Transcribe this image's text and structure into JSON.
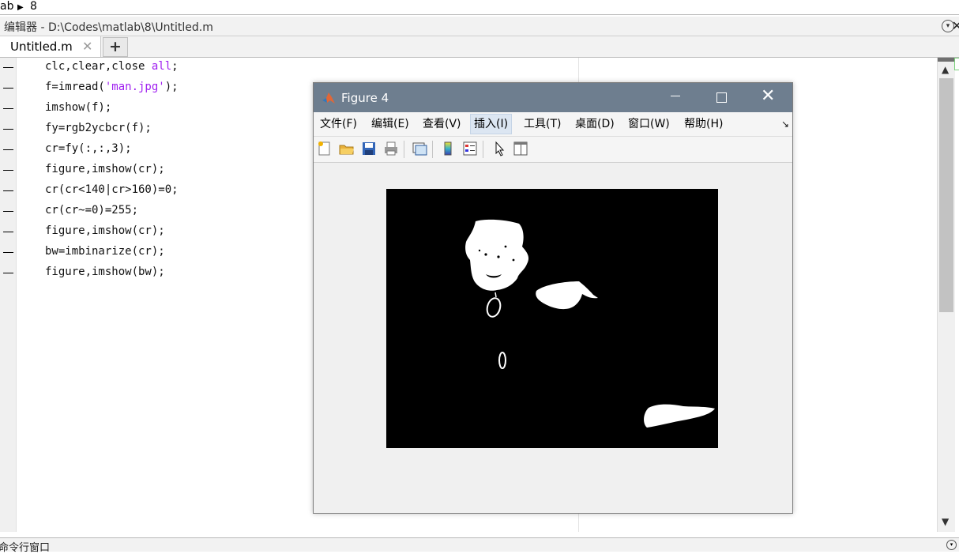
{
  "breadcrumb": {
    "left_text": "ab",
    "current": "8"
  },
  "editor": {
    "title": "编辑器 - D:\\Codes\\matlab\\8\\Untitled.m",
    "tabs": [
      {
        "label": "Untitled.m"
      }
    ],
    "add_tab": "+",
    "close_tab": "✕"
  },
  "code_lines": [
    {
      "parts": [
        {
          "t": "clc,clear,close ",
          "c": "plain"
        },
        {
          "t": "all",
          "c": "kw"
        },
        {
          "t": ";",
          "c": "plain"
        }
      ]
    },
    {
      "parts": [
        {
          "t": "f=imread(",
          "c": "plain"
        },
        {
          "t": "'man.jpg'",
          "c": "str"
        },
        {
          "t": ");",
          "c": "plain"
        }
      ]
    },
    {
      "parts": [
        {
          "t": "imshow(f);",
          "c": "plain"
        }
      ]
    },
    {
      "parts": [
        {
          "t": "fy=rgb2ycbcr(f);",
          "c": "plain"
        }
      ]
    },
    {
      "parts": [
        {
          "t": "cr=fy(:,:,3);",
          "c": "plain"
        }
      ]
    },
    {
      "parts": [
        {
          "t": "figure,imshow(cr);",
          "c": "plain"
        }
      ]
    },
    {
      "parts": [
        {
          "t": "cr(cr<140|cr>160)=0;",
          "c": "plain"
        }
      ]
    },
    {
      "parts": [
        {
          "t": "cr(cr~=0)=255;",
          "c": "plain"
        }
      ]
    },
    {
      "parts": [
        {
          "t": "figure,imshow(cr);",
          "c": "plain"
        }
      ]
    },
    {
      "parts": [
        {
          "t": "bw=imbinarize(cr);",
          "c": "plain"
        }
      ]
    },
    {
      "parts": [
        {
          "t": "figure,imshow(bw);",
          "c": "plain"
        }
      ]
    }
  ],
  "command_window": {
    "label": "命令行窗口"
  },
  "figure": {
    "title": "Figure 4",
    "menu": [
      {
        "label": "文件(F)"
      },
      {
        "label": "编辑(E)"
      },
      {
        "label": "查看(V)"
      },
      {
        "label": "插入(I)",
        "active": true
      },
      {
        "label": "工具(T)"
      },
      {
        "label": "桌面(D)"
      },
      {
        "label": "窗口(W)"
      },
      {
        "label": "帮助(H)"
      }
    ],
    "toolbar": [
      "new-figure-icon",
      "open-file-icon",
      "save-icon",
      "print-icon",
      "link-plot-icon",
      "insert-colorbar-icon",
      "insert-legend-icon",
      "edit-plot-arrow-icon",
      "property-inspector-icon"
    ]
  },
  "colors": {
    "titlebar": "#6e7e8f",
    "keyword": "#a020f0",
    "string": "#a020f0"
  }
}
